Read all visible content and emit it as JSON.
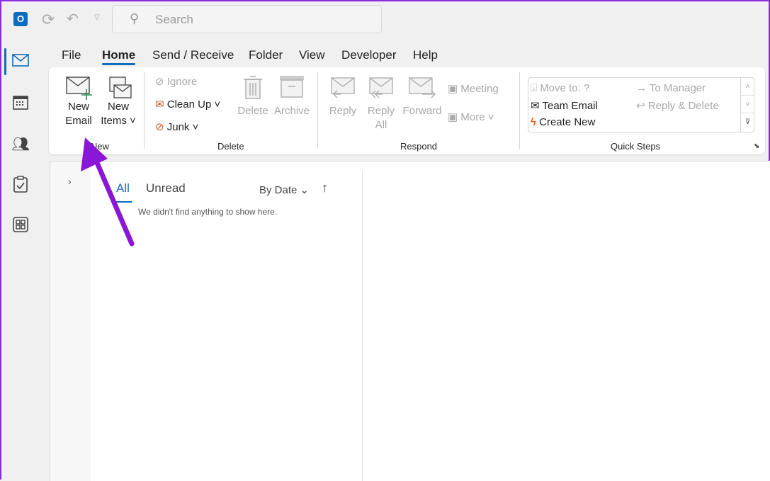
{
  "titlebar": {
    "search_placeholder": "Search"
  },
  "ribbon_tabs": [
    "File",
    "Home",
    "Send / Receive",
    "Folder",
    "View",
    "Developer",
    "Help"
  ],
  "active_tab": "Home",
  "groups": {
    "new": {
      "label": "New",
      "new_email": [
        "New",
        "Email"
      ],
      "new_items": [
        "New",
        "Items"
      ]
    },
    "delete": {
      "label": "Delete",
      "ignore": "Ignore",
      "clean_up": "Clean Up",
      "junk": "Junk",
      "delete": "Delete",
      "archive": "Archive"
    },
    "respond": {
      "label": "Respond",
      "reply": "Reply",
      "reply_all": [
        "Reply",
        "All"
      ],
      "forward": "Forward",
      "meeting": "Meeting",
      "more": "More"
    },
    "quick_steps": {
      "label": "Quick Steps",
      "items": [
        "Move to: ?",
        "Team Email",
        "Create New",
        "To Manager",
        "Reply & Delete"
      ]
    }
  },
  "message_list": {
    "filters": [
      "All",
      "Unread"
    ],
    "active_filter": "All",
    "sort": "By Date",
    "empty_text": "We didn't find anything to show here."
  },
  "colors": {
    "accent": "#0f6cbd",
    "annotation_arrow": "#8a16d6",
    "border": "#8a2be2"
  }
}
